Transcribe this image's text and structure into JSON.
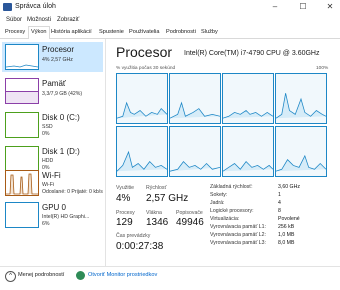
{
  "window": {
    "title": "Správca úloh",
    "buttons": [
      "–",
      "☐",
      "✕"
    ]
  },
  "menu": [
    "Súbor",
    "Možnosti",
    "Zobraziť"
  ],
  "tabs": [
    "Procesy",
    "Výkon",
    "História aplikácií",
    "Spustenie",
    "Používatelia",
    "Podrobnosti",
    "Služby"
  ],
  "sidebar": [
    {
      "title": "Procesor",
      "sub1": "4% 2,57 GHz",
      "sub2": "",
      "color": "#1d87c6",
      "selected": true
    },
    {
      "title": "Pamäť",
      "sub1": "3,3/7,9 GB (42%)",
      "sub2": "",
      "color": "#8b3fa8",
      "selected": false
    },
    {
      "title": "Disk 0 (C:)",
      "sub1": "SSD",
      "sub2": "0%",
      "color": "#4da01d",
      "selected": false
    },
    {
      "title": "Disk 1 (D:)",
      "sub1": "HDD",
      "sub2": "0%",
      "color": "#4da01d",
      "selected": false
    },
    {
      "title": "Wi-Fi",
      "sub1": "Wi-Fi",
      "sub2": "Odoslané: 0 Prijaté: 0 kb/s",
      "color": "#a75b16",
      "selected": false
    },
    {
      "title": "GPU 0",
      "sub1": "Intel(R) HD Graphi...",
      "sub2": "6%",
      "color": "#1d87c6",
      "selected": false
    }
  ],
  "main": {
    "title": "Procesor",
    "cpu_name": "Intel(R) Core(TM) i7-4790 CPU @ 3.60GHz",
    "graph_caption": "% využitia počas 30 sekúnd",
    "graph_max": "100%",
    "stats": {
      "usage_label": "Využitie",
      "usage_value": "4%",
      "speed_label": "Rýchlosť",
      "speed_value": "2,57 GHz",
      "processes_label": "Procesy",
      "processes_value": "129",
      "threads_label": "Vlákna",
      "threads_value": "1346",
      "handles_label": "Popisovače",
      "handles_value": "49946",
      "uptime_label": "Čas prevádzky",
      "uptime_value": "0:00:27:38"
    },
    "specs": [
      {
        "k": "Základná rýchlosť:",
        "v": "3,60 GHz"
      },
      {
        "k": "Sokety:",
        "v": "1"
      },
      {
        "k": "Jadrá:",
        "v": "4"
      },
      {
        "k": "Logické procesory:",
        "v": "8"
      },
      {
        "k": "Virtualizácia:",
        "v": "Povolené"
      },
      {
        "k": "Vyrovnávacia pamäť L1:",
        "v": "256 kB"
      },
      {
        "k": "Vyrovnávacia pamäť L2:",
        "v": "1,0 MB"
      },
      {
        "k": "Vyrovnávacia pamäť L3:",
        "v": "8,0 MB"
      }
    ]
  },
  "footer": {
    "fewer_details": "Menej podrobností",
    "open_monitor": "Otvoriť Monitor prostriedkov"
  }
}
